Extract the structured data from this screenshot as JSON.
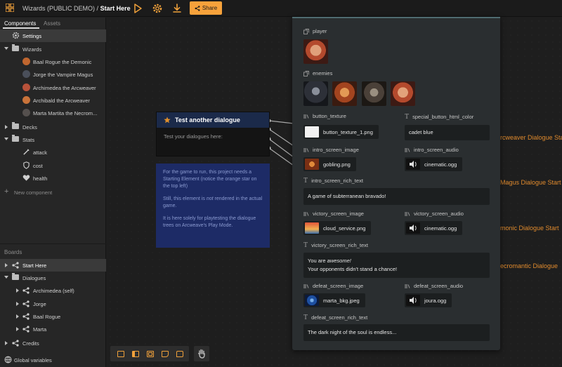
{
  "header": {
    "project": "Wizards (PUBLIC DEMO)",
    "separator": "/",
    "board": "Start Here",
    "share_label": "Share"
  },
  "sidebar": {
    "tabs": [
      "Components",
      "Assets"
    ],
    "settings": "Settings",
    "wizards_folder": "Wizards",
    "wizards": [
      "Baal Rogue the Demonic",
      "Jorge the Vampire Magus",
      "Archimedea the Arcweaver",
      "Archibald the Arcweaver",
      "Marta Martita the Necrom..."
    ],
    "decks_folder": "Decks",
    "stats_folder": "Stats",
    "stats": [
      "attack",
      "cost",
      "health"
    ],
    "new_component": "New component",
    "boards_heading": "Boards",
    "start_here": "Start Here",
    "dialogues_folder": "Dialogues",
    "dialogues": [
      "Archimedea (self)",
      "Jorge",
      "Baal Rogue",
      "Marta"
    ],
    "credits": "Credits",
    "global_variables": "Global variables"
  },
  "canvas": {
    "dialog_title": "Test another dialogue",
    "dialog_body": "Test your dialogues here:",
    "note_p1": "For the game to run, this project needs a Starting Element (notice the orange star on the top left)",
    "note_p2_a": "Still, this element is ",
    "note_p2_em": "not",
    "note_p2_b": " rendered in the actual game.",
    "note_p3": "It is here solely for playtesting the dialogue trees on Arcweave's Play Mode.",
    "edge_labels": [
      "rcweaver Dialogue Star",
      "Magus Dialogue Start",
      "monic Dialogue Start",
      "ecromantic Dialogue"
    ]
  },
  "panel": {
    "player_label": "player",
    "enemies_label": "enemies",
    "button_texture_label": "button_texture",
    "button_texture_file": "button_texture_1.png",
    "special_label": "special_button_html_color",
    "special_value": "cadet blue",
    "intro_image_label": "intro_screen_image",
    "intro_image_file": "gobling.png",
    "intro_audio_label": "intro_screen_audio",
    "intro_audio_file": "cinematic.ogg",
    "intro_text_label": "intro_screen_rich_text",
    "intro_text": "A game of subterranean bravado!",
    "victory_image_label": "victory_screen_image",
    "victory_image_file": "cloud_service.png",
    "victory_audio_label": "victory_screen_audio",
    "victory_audio_file": "cinematic.ogg",
    "victory_text_label": "victory_screen_rich_text",
    "victory_text_a": "You are ",
    "victory_text_em": "awesome!",
    "victory_text_line2": "Your opponents didn't stand a chance!",
    "defeat_image_label": "defeat_screen_image",
    "defeat_image_file": "marta_bkg.jpeg",
    "defeat_audio_label": "defeat_screen_audio",
    "defeat_audio_file": "joura.ogg",
    "defeat_text_label": "defeat_screen_rich_text",
    "defeat_text": "The dark night of the soul is endless..."
  },
  "colors": {
    "accent": "#f7a23b",
    "panel_bg": "#2a2e30",
    "note_bg": "#1d2b66",
    "dialog_header": "#1b2a4a"
  }
}
